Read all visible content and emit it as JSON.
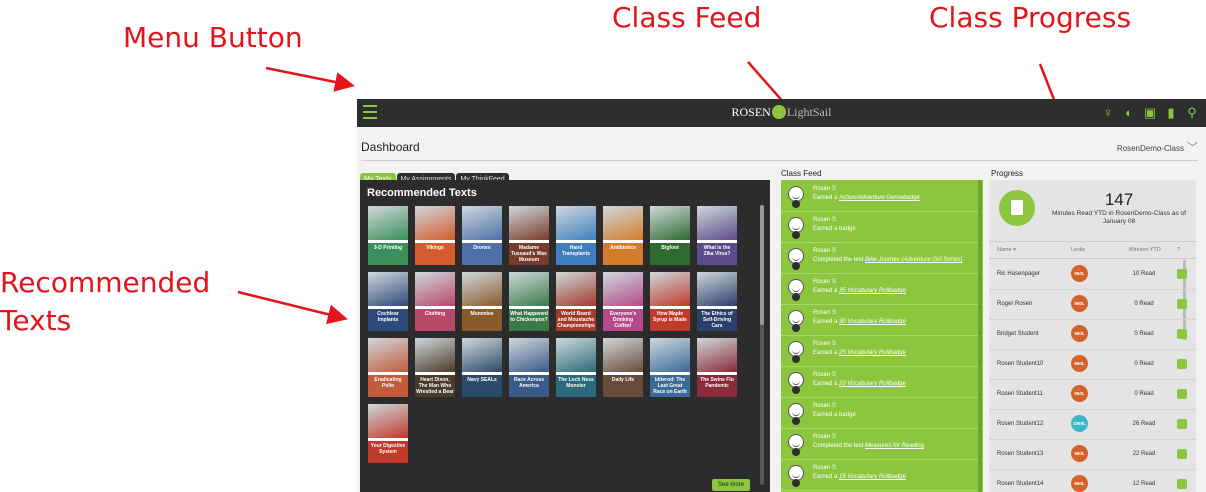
{
  "annotations": {
    "menu_button": "Menu Button",
    "class_feed": "Class Feed",
    "class_progress": "Class Progress",
    "recommended_texts": "Recommended\nTexts"
  },
  "header": {
    "brand_left": "ROSEN",
    "brand_right": "LightSail",
    "icons": [
      "lightbulb-icon",
      "chat-icon",
      "award-icon",
      "library-icon",
      "search-icon"
    ]
  },
  "dashboard": {
    "title": "Dashboard",
    "class_name": "RosenDemo-Class"
  },
  "tabs": [
    "My Texts",
    "My Assignments",
    "My ThinkFeed"
  ],
  "recommended": {
    "heading": "Recommended Texts",
    "see_more": "See more",
    "books": [
      {
        "title": "3-D Printing",
        "color": "#3a8f5a"
      },
      {
        "title": "Vikings",
        "color": "#d35b2e"
      },
      {
        "title": "Drones",
        "color": "#4e6fa8"
      },
      {
        "title": "Madame Tussaud's Wax Museum",
        "color": "#7a3b2a"
      },
      {
        "title": "Hand Transplants",
        "color": "#3f7fbf"
      },
      {
        "title": "Antibiotics",
        "color": "#d47c2c"
      },
      {
        "title": "Bigfoot",
        "color": "#2f6b2f"
      },
      {
        "title": "What is the Zika Virus?",
        "color": "#5b4b8a"
      },
      {
        "title": "Cochlear Implants",
        "color": "#2e4a7a"
      },
      {
        "title": "Clothing",
        "color": "#b8486a"
      },
      {
        "title": "Mummies",
        "color": "#8a5a2a"
      },
      {
        "title": "What Happened to Chickenpox?",
        "color": "#3a7a4a"
      },
      {
        "title": "World Beard and Moustache Championships",
        "color": "#a33a2a"
      },
      {
        "title": "Everyone's Drinking Coffee!",
        "color": "#b44a8a"
      },
      {
        "title": "How Maple Syrup is Made",
        "color": "#c0392b"
      },
      {
        "title": "The Ethics of Self-Driving Cars",
        "color": "#2c3e6a"
      },
      {
        "title": "Eradicating Polio",
        "color": "#c25b3a"
      },
      {
        "title": "Heart Dixon, The Man Who Wrestled a Bear",
        "color": "#4a3a2a"
      },
      {
        "title": "Navy SEALs",
        "color": "#2a4a6a"
      },
      {
        "title": "Race Across America",
        "color": "#3a5a8a"
      },
      {
        "title": "The Loch Ness Monster",
        "color": "#2a6a7a"
      },
      {
        "title": "Daily Life",
        "color": "#6a4a3a"
      },
      {
        "title": "Iditerod: The Last Great Race on Earth",
        "color": "#3a6a9a"
      },
      {
        "title": "The Swine Flu Pandemic",
        "color": "#8a2a3a"
      },
      {
        "title": "Your Digestive System",
        "color": "#c0392b"
      }
    ]
  },
  "feed": {
    "label": "Class Feed",
    "items": [
      {
        "name": "Rosen S",
        "prefix": "Earned a ",
        "em": "Action/Adventure Genrebadge"
      },
      {
        "name": "Rosen S",
        "prefix": "Earned a badge",
        "em": ""
      },
      {
        "name": "Rosen S",
        "prefix": "Completed the text ",
        "em": "Bike Journey (Adventure Girl Series)"
      },
      {
        "name": "Rosen S",
        "prefix": "Earned a ",
        "em": "35 Vocabulary Rollbadge"
      },
      {
        "name": "Rosen S",
        "prefix": "Earned a ",
        "em": "30 Vocabulary Rollbadge"
      },
      {
        "name": "Rosen S",
        "prefix": "Earned a ",
        "em": "25 Vocabulary Rollbadge"
      },
      {
        "name": "Rosen S",
        "prefix": "Earned a ",
        "em": "20 Vocabulary Rollbadge"
      },
      {
        "name": "Rosen S",
        "prefix": "Earned a badge",
        "em": ""
      },
      {
        "name": "Rosen S",
        "prefix": "Completed the text ",
        "em": "Measures for Reading"
      },
      {
        "name": "Rosen S",
        "prefix": "Earned a ",
        "em": "15 Vocabulary Rollbadge"
      }
    ]
  },
  "progress": {
    "label": "Progress",
    "total": "147",
    "summary": "Minutes Read YTD in RosenDemo-Class as of January 08",
    "columns": [
      "Name ▾",
      "Lexile",
      "Minutes YTD",
      "?"
    ],
    "students": [
      {
        "name": "Ric Hasenpager",
        "lexile": "960L",
        "lexile_color": "#d4622a",
        "minutes": "10 Read"
      },
      {
        "name": "Roger Rosen",
        "lexile": "960L",
        "lexile_color": "#d4622a",
        "minutes": "0 Read"
      },
      {
        "name": "Bridget Student",
        "lexile": "960L",
        "lexile_color": "#d4622a",
        "minutes": "0 Read"
      },
      {
        "name": "Rosen Student10",
        "lexile": "960L",
        "lexile_color": "#d4622a",
        "minutes": "0 Read"
      },
      {
        "name": "Rosen Student11",
        "lexile": "960L",
        "lexile_color": "#d4622a",
        "minutes": "0 Read"
      },
      {
        "name": "Rosen Student12",
        "lexile": "1060L",
        "lexile_color": "#3bb8c8",
        "minutes": "26 Read"
      },
      {
        "name": "Rosen Student13",
        "lexile": "960L",
        "lexile_color": "#d4622a",
        "minutes": "22 Read"
      },
      {
        "name": "Rosen Student14",
        "lexile": "960L",
        "lexile_color": "#d4622a",
        "minutes": "12 Read"
      }
    ]
  }
}
